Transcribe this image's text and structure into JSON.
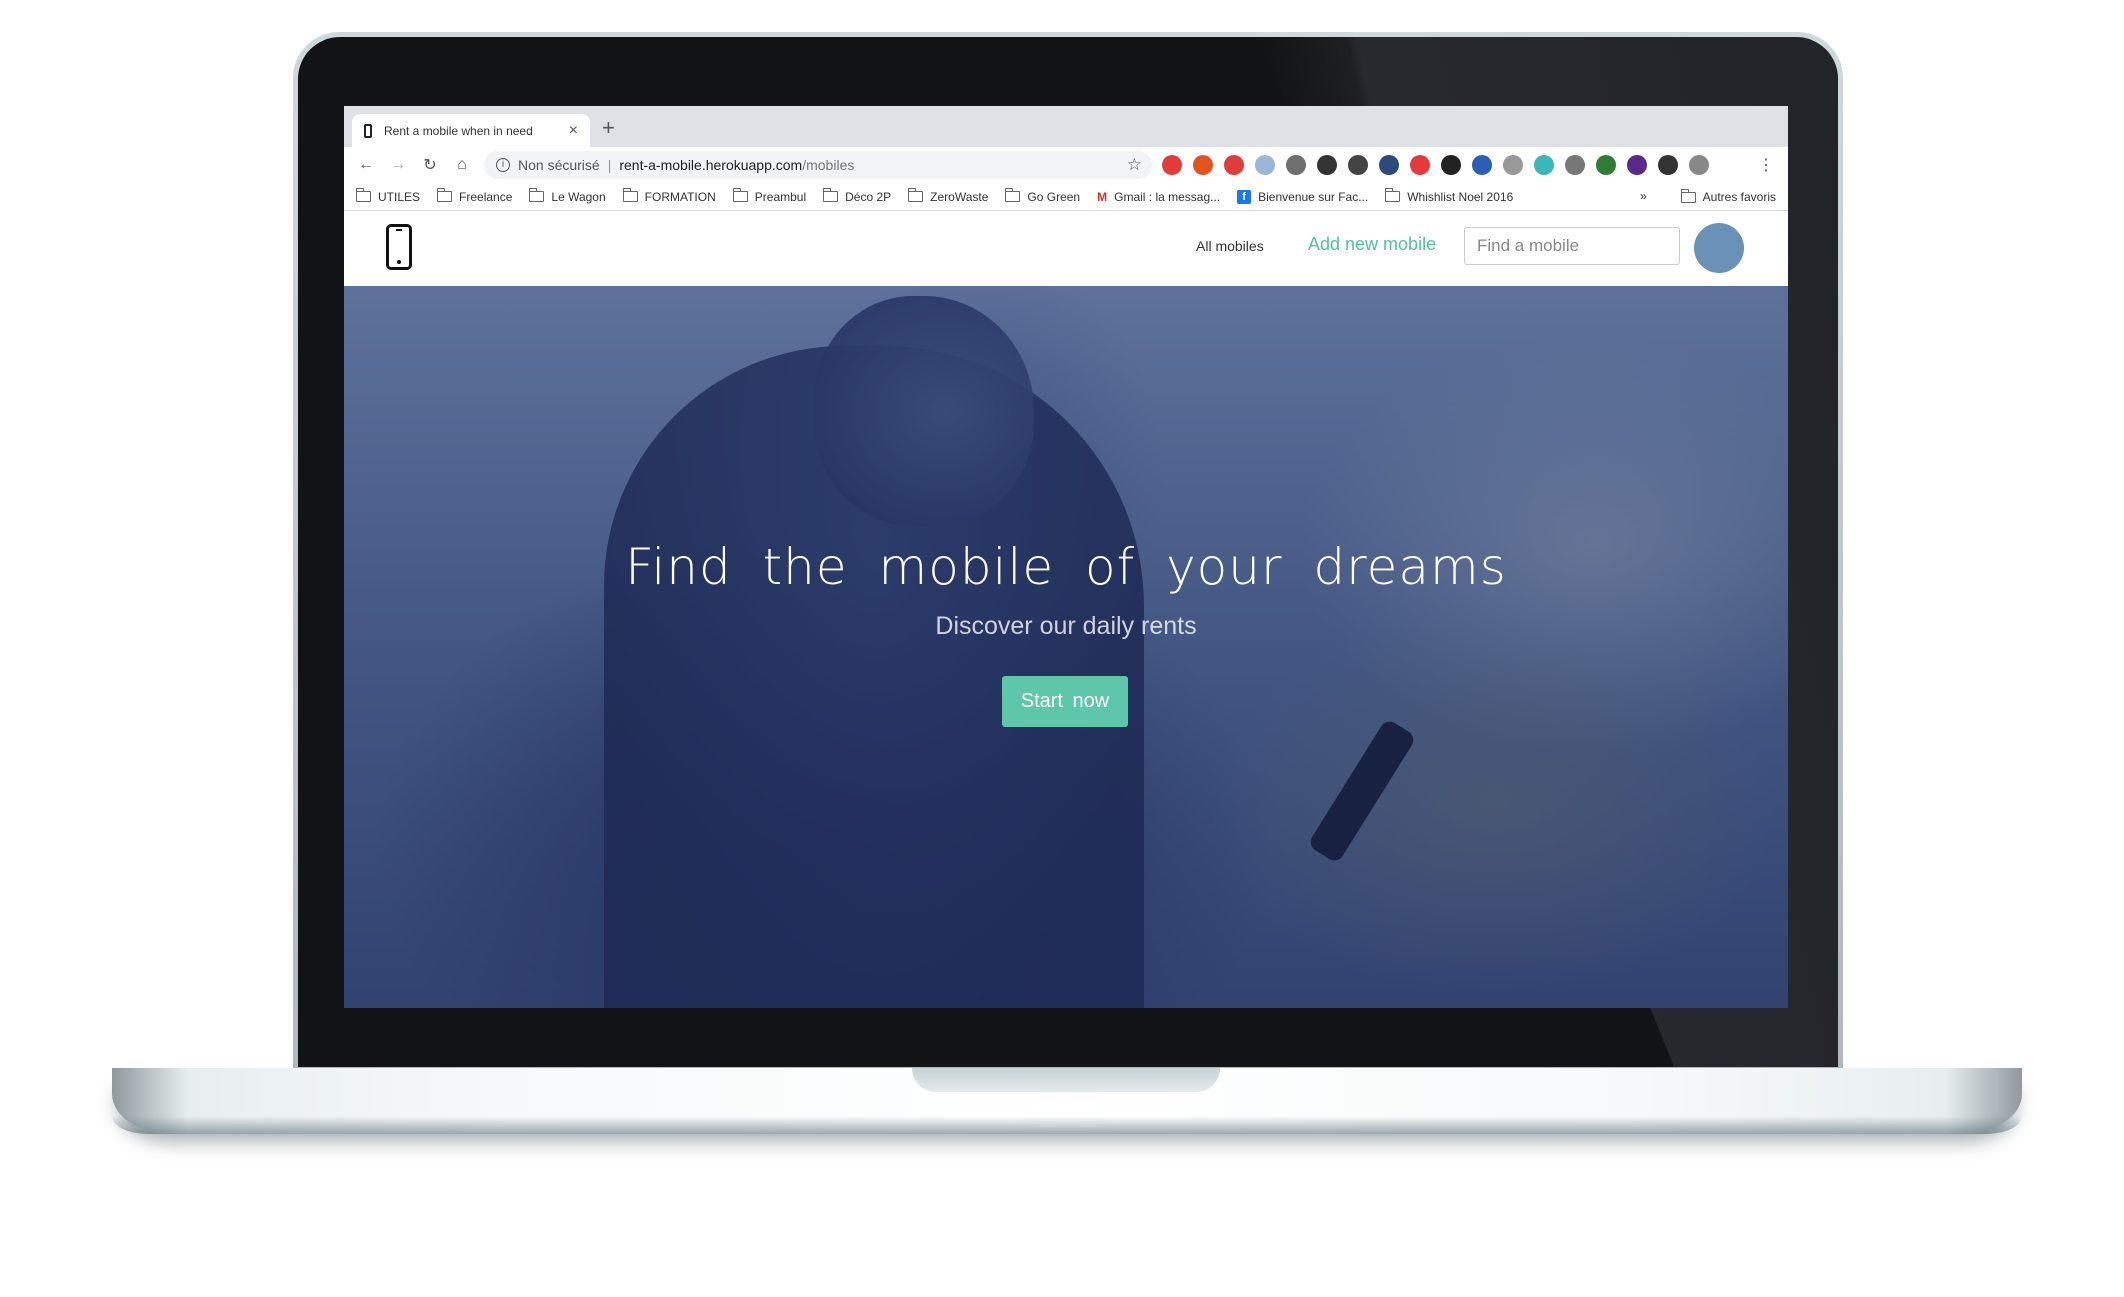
{
  "browser": {
    "tab_title": "Rent a mobile when in need",
    "new_tab_label": "+",
    "tab_close_label": "×",
    "insecure_label": "Non sécurisé",
    "url_domain": "rent-a-mobile.herokuapp.com",
    "url_path": "/mobiles",
    "bookmarks": [
      {
        "label": "UTILES"
      },
      {
        "label": "Freelance"
      },
      {
        "label": "Le Wagon"
      },
      {
        "label": "FORMATION"
      },
      {
        "label": "Preambul"
      },
      {
        "label": "Déco 2P"
      },
      {
        "label": "ZeroWaste"
      },
      {
        "label": "Go Green"
      },
      {
        "label": "Gmail : la messag..."
      },
      {
        "label": "Bienvenue sur Fac..."
      },
      {
        "label": "Whishlist Noel 2016"
      }
    ],
    "more_label": "»",
    "other_bookmarks": "Autres favoris",
    "extension_colors": [
      "#e23b3b",
      "#e2531f",
      "#e23b3b",
      "#9bb7d8",
      "#6f6f6f",
      "#333333",
      "#444444",
      "#2c4a7a",
      "#e23b3b",
      "#222222",
      "#2b5fb5",
      "#999999",
      "#3bb7b7",
      "#777777",
      "#2e7d32",
      "#5a2a8a",
      "#333333",
      "#888888"
    ]
  },
  "site": {
    "nav_all_mobiles": "All mobiles",
    "nav_add_mobile": "Add new mobile",
    "search_placeholder": "Find a mobile",
    "accent_color": "#4fc3a1"
  },
  "hero": {
    "title": "Find the mobile of your dreams",
    "subtitle": "Discover our daily rents",
    "cta": "Start now"
  }
}
